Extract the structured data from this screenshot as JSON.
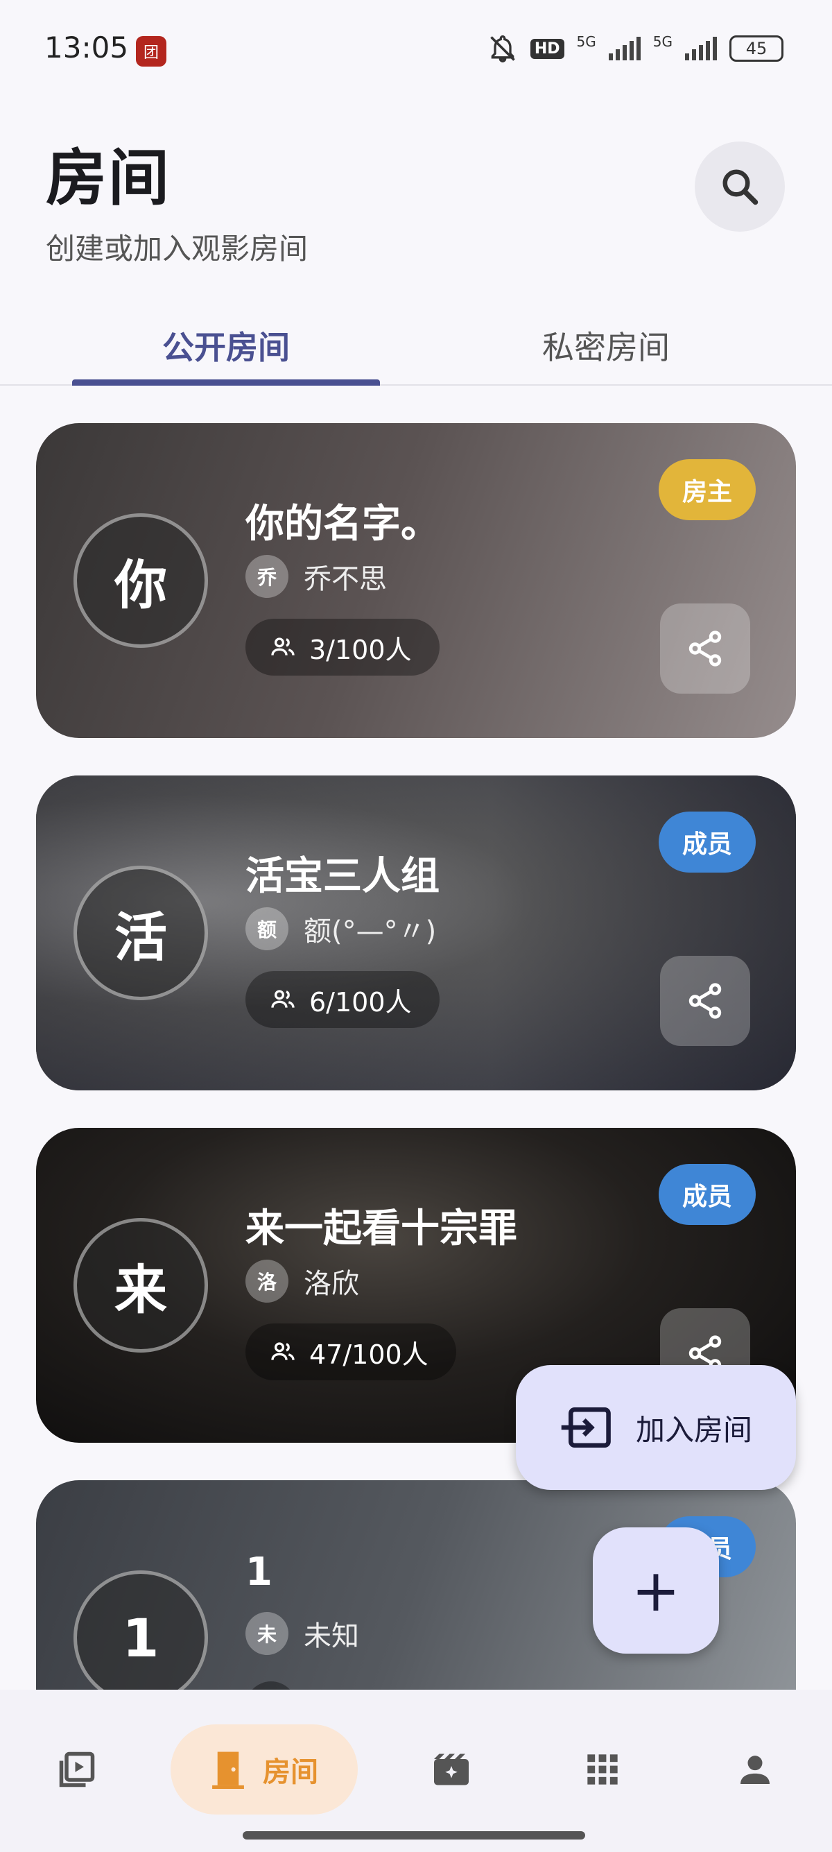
{
  "status_bar": {
    "time": "13:05",
    "app_badge": "团",
    "net1": "5G",
    "net2": "5G",
    "hd": "HD",
    "battery": "45"
  },
  "header": {
    "title": "房间",
    "subtitle": "创建或加入观影房间"
  },
  "tabs": [
    {
      "label": "公开房间",
      "active": true
    },
    {
      "label": "私密房间",
      "active": false
    }
  ],
  "rooms": [
    {
      "avatar": "你",
      "name": "你的名字。",
      "owner_initial": "乔",
      "owner": "乔不思",
      "members": "3/100人",
      "role": "房主"
    },
    {
      "avatar": "活",
      "name": "活宝三人组",
      "owner_initial": "额",
      "owner": "额(°—°〃)",
      "members": "6/100人",
      "role": "成员"
    },
    {
      "avatar": "来",
      "name": "来一起看十宗罪",
      "owner_initial": "洛",
      "owner": "洛欣",
      "members": "47/100人",
      "role": "成员"
    },
    {
      "avatar": "1",
      "name": "1",
      "owner_initial": "未",
      "owner": "未知",
      "members": "",
      "role": "成员"
    }
  ],
  "fab": {
    "join_label": "加入房间",
    "add_symbol": "+"
  },
  "bottom_nav": {
    "items": [
      {
        "icon": "video-library-icon"
      },
      {
        "icon": "door-icon",
        "label": "房间",
        "active": true
      },
      {
        "icon": "movie-sparkle-icon"
      },
      {
        "icon": "apps-grid-icon"
      },
      {
        "icon": "person-icon"
      }
    ]
  },
  "colors": {
    "primary": "#4a5091",
    "owner_badge": "#e2b53a",
    "member_badge": "#3f86d6",
    "nav_active": "#e6922f",
    "fab": "#e1e1fb"
  }
}
